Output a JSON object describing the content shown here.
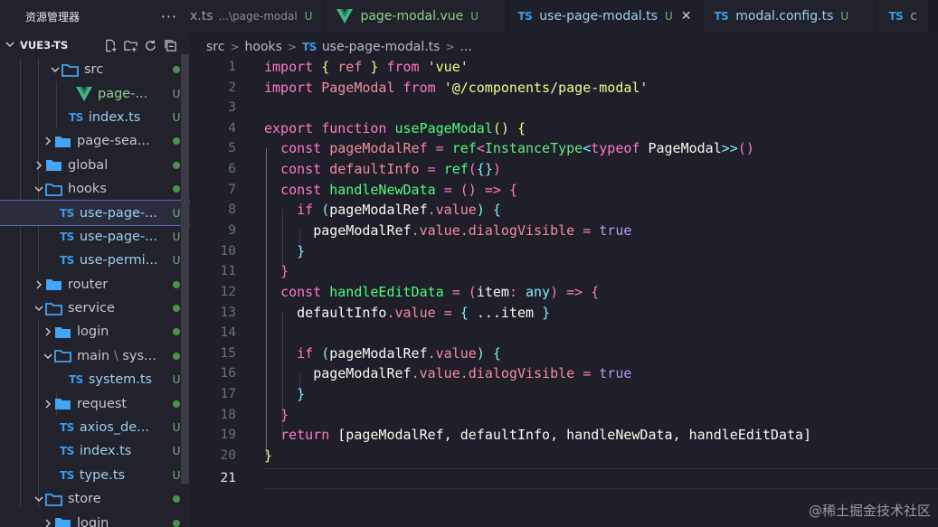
{
  "sidebar": {
    "title": "资源管理器",
    "more": "···",
    "project": "VUE3-TS",
    "rows": [
      {
        "label": "src",
        "badge": "",
        "dot": true
      },
      {
        "label": "page-...",
        "badge": "U"
      },
      {
        "label": "index.ts",
        "badge": "U"
      },
      {
        "label": "page-sea...",
        "dot": true
      },
      {
        "label": "global",
        "dot": true
      },
      {
        "label": "hooks",
        "dot": true
      },
      {
        "label": "use-page-...",
        "badge": "U"
      },
      {
        "label": "use-page-...",
        "badge": "U"
      },
      {
        "label": "use-permi...",
        "badge": "U"
      },
      {
        "label": "router",
        "dot": true
      },
      {
        "label": "service",
        "dot": true
      },
      {
        "label": "login",
        "dot": true
      },
      {
        "label": "main",
        "label2": "sys...",
        "dot": true
      },
      {
        "label": "system.ts",
        "badge": "U"
      },
      {
        "label": "request",
        "dot": true
      },
      {
        "label": "axios_de...",
        "badge": "U"
      },
      {
        "label": "index.ts",
        "badge": "U"
      },
      {
        "label": "type.ts",
        "badge": "U"
      },
      {
        "label": "store",
        "dot": true
      },
      {
        "label": "login",
        "dot": true
      }
    ]
  },
  "tabs": [
    {
      "label": "x.ts",
      "desc": "...\\page-modal",
      "badge": "U"
    },
    {
      "icon": "V",
      "label": "page-modal.vue",
      "badge": "U"
    },
    {
      "icon": "TS",
      "label": "use-page-modal.ts",
      "badge": "U",
      "close": "✕"
    },
    {
      "icon": "TS",
      "label": "modal.config.ts",
      "badge": "U"
    },
    {
      "icon": "TS",
      "label": "c"
    }
  ],
  "breadcrumb": {
    "a": "src",
    "b": "hooks",
    "icon": "TS",
    "c": "use-page-modal.ts",
    "d": "..."
  },
  "line_numbers": [
    "1",
    "2",
    "3",
    "4",
    "5",
    "6",
    "7",
    "8",
    "9",
    "10",
    "11",
    "12",
    "13",
    "14",
    "15",
    "16",
    "17",
    "18",
    "19",
    "20",
    "21"
  ],
  "code": {
    "l1": [
      "import",
      "{",
      "ref",
      "}",
      "from",
      "'vue'"
    ],
    "l2": [
      "import",
      "PageModal",
      "from",
      "'@/components/page-modal'"
    ],
    "l4": [
      "export",
      "function",
      "usePageModal",
      "()",
      "{"
    ],
    "l5": [
      "const",
      "pageModalRef",
      "=",
      "ref",
      "<",
      "InstanceType",
      "<",
      "typeof",
      "PageModal",
      ">>",
      "()"
    ],
    "l6": [
      "const",
      "defaultInfo",
      "=",
      "ref",
      "(",
      "{}",
      ")"
    ],
    "l7": [
      "const",
      "handleNewData",
      "=",
      "()",
      "=>",
      "{"
    ],
    "l8": [
      "if",
      "(",
      "pageModalRef",
      ".value",
      ")",
      "{"
    ],
    "l9": [
      "pageModalRef",
      ".value",
      ".dialogVisible",
      "=",
      "true"
    ],
    "l10": [
      "}"
    ],
    "l11": [
      "}"
    ],
    "l12": [
      "const",
      "handleEditData",
      "=",
      "(",
      "item",
      ":",
      "any",
      ")",
      "=>",
      "{"
    ],
    "l13": [
      "defaultInfo",
      ".value",
      "=",
      "{",
      "...item",
      "}"
    ],
    "l15": [
      "if",
      "(",
      "pageModalRef",
      ".value",
      ")",
      "{"
    ],
    "l16": [
      "pageModalRef",
      ".value",
      ".dialogVisible",
      "=",
      "true"
    ],
    "l17": [
      "}"
    ],
    "l18": [
      "}"
    ],
    "l19": [
      "return",
      "[pageModalRef, defaultInfo, handleNewData, handleEditData]"
    ],
    "l20": [
      "}"
    ]
  },
  "watermark": "@稀土掘金技术社区",
  "colors": {
    "keyword": "#ff79c6",
    "function": "#50fa7b",
    "string": "#f1fa8c",
    "type": "#8be9fd",
    "bool": "#bd93f9"
  }
}
